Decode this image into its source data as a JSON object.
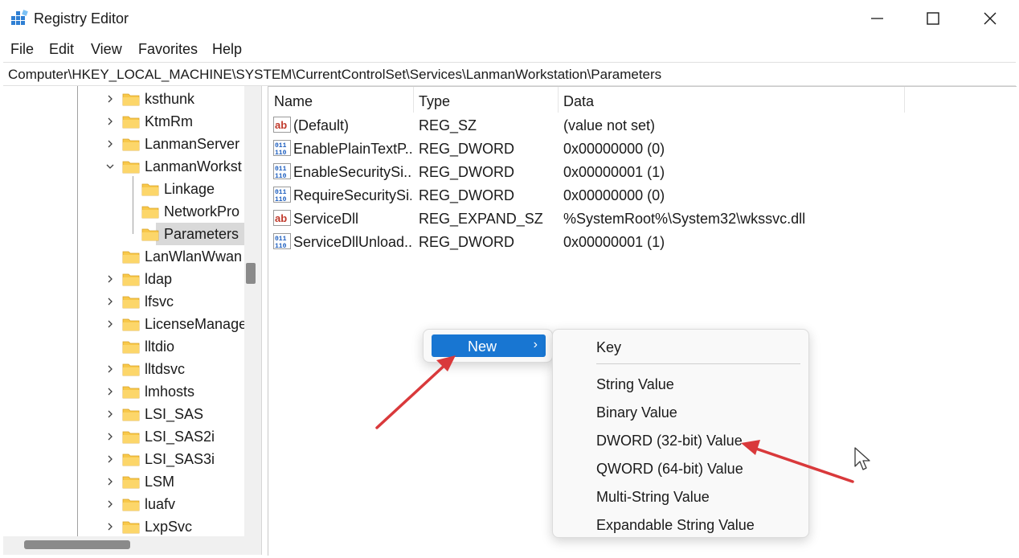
{
  "window": {
    "title": "Registry Editor"
  },
  "menu": [
    "File",
    "Edit",
    "View",
    "Favorites",
    "Help"
  ],
  "address": "Computer\\HKEY_LOCAL_MACHINE\\SYSTEM\\CurrentControlSet\\Services\\LanmanWorkstation\\Parameters",
  "tree": [
    {
      "label": "ksthunk",
      "expander": "collapsed"
    },
    {
      "label": "KtmRm",
      "expander": "collapsed"
    },
    {
      "label": "LanmanServer",
      "expander": "collapsed"
    },
    {
      "label": "LanmanWorkst",
      "expander": "expanded"
    },
    {
      "label": "Linkage",
      "expander": "none",
      "child": true
    },
    {
      "label": "NetworkPro",
      "expander": "none",
      "child": true
    },
    {
      "label": "Parameters",
      "expander": "none",
      "child": true,
      "selected": true
    },
    {
      "label": "LanWlanWwan",
      "expander": "none"
    },
    {
      "label": "ldap",
      "expander": "collapsed"
    },
    {
      "label": "lfsvc",
      "expander": "collapsed"
    },
    {
      "label": "LicenseManage",
      "expander": "collapsed"
    },
    {
      "label": "lltdio",
      "expander": "none"
    },
    {
      "label": "lltdsvc",
      "expander": "collapsed"
    },
    {
      "label": "lmhosts",
      "expander": "collapsed"
    },
    {
      "label": "LSI_SAS",
      "expander": "collapsed"
    },
    {
      "label": "LSI_SAS2i",
      "expander": "collapsed"
    },
    {
      "label": "LSI_SAS3i",
      "expander": "collapsed"
    },
    {
      "label": "LSM",
      "expander": "collapsed"
    },
    {
      "label": "luafv",
      "expander": "collapsed"
    },
    {
      "label": "LxpSvc",
      "expander": "collapsed"
    }
  ],
  "columns": [
    "Name",
    "Type",
    "Data"
  ],
  "values": [
    {
      "name": "(Default)",
      "type": "REG_SZ",
      "data": "(value not set)",
      "icon": "string-value-icon"
    },
    {
      "name": "EnablePlainTextP...",
      "type": "REG_DWORD",
      "data": "0x00000000 (0)",
      "icon": "binary-value-icon"
    },
    {
      "name": "EnableSecuritySi...",
      "type": "REG_DWORD",
      "data": "0x00000001 (1)",
      "icon": "binary-value-icon"
    },
    {
      "name": "RequireSecuritySi...",
      "type": "REG_DWORD",
      "data": "0x00000000 (0)",
      "icon": "binary-value-icon"
    },
    {
      "name": "ServiceDll",
      "type": "REG_EXPAND_SZ",
      "data": "%SystemRoot%\\System32\\wkssvc.dll",
      "icon": "string-value-icon"
    },
    {
      "name": "ServiceDllUnload...",
      "type": "REG_DWORD",
      "data": "0x00000001 (1)",
      "icon": "binary-value-icon"
    }
  ],
  "context_menu": {
    "item": "New",
    "arrow": "›"
  },
  "submenu": {
    "items": [
      "Key",
      "String Value",
      "Binary Value",
      "DWORD (32-bit) Value",
      "QWORD (64-bit) Value",
      "Multi-String Value",
      "Expandable String Value"
    ]
  },
  "colors": {
    "accent": "#1876d2",
    "annotation_arrow": "#d9393b",
    "folder": "#f8c84a"
  }
}
